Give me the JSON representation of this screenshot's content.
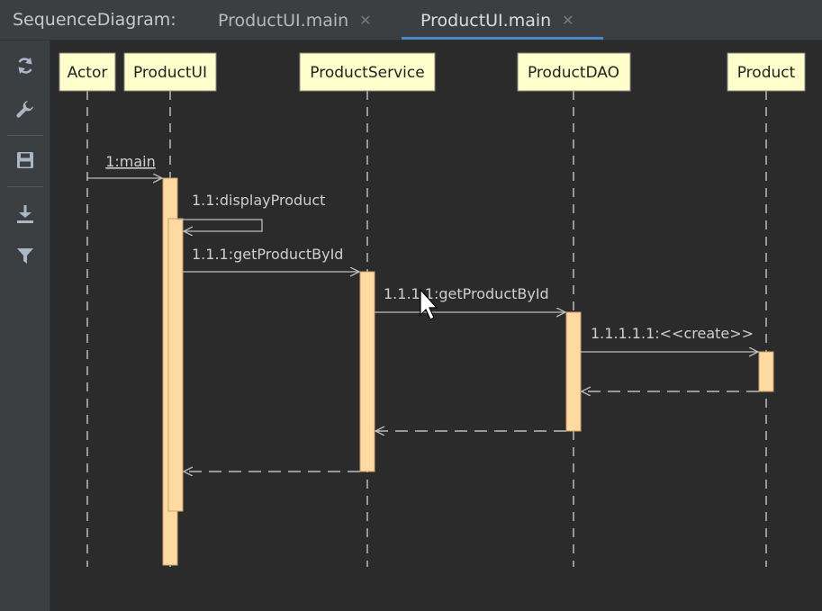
{
  "toolwindow": {
    "title": "SequenceDiagram:"
  },
  "tabs": [
    {
      "label": "ProductUI.main",
      "active": false
    },
    {
      "label": "ProductUI.main",
      "active": true
    }
  ],
  "toolbar": {
    "buttons": [
      {
        "icon": "refresh-icon"
      },
      {
        "icon": "wrench-icon"
      },
      {
        "icon": "save-icon"
      },
      {
        "icon": "export-icon"
      },
      {
        "icon": "filter-icon"
      }
    ]
  },
  "diagram": {
    "participants": [
      "Actor",
      "ProductUI",
      "ProductService",
      "ProductDAO",
      "Product"
    ],
    "messages": [
      {
        "label": "1:main",
        "from": "Actor",
        "to": "ProductUI",
        "kind": "call"
      },
      {
        "label": "1.1:displayProduct",
        "from": "ProductUI",
        "to": "ProductUI",
        "kind": "self"
      },
      {
        "label": "1.1.1:getProductById",
        "from": "ProductUI",
        "to": "ProductService",
        "kind": "call"
      },
      {
        "label": "1.1.1.1:getProductById",
        "from": "ProductService",
        "to": "ProductDAO",
        "kind": "call"
      },
      {
        "label": "1.1.1.1.1:<<create>>",
        "from": "ProductDAO",
        "to": "Product",
        "kind": "create"
      },
      {
        "label": "",
        "from": "Product",
        "to": "ProductDAO",
        "kind": "return"
      },
      {
        "label": "",
        "from": "ProductDAO",
        "to": "ProductService",
        "kind": "return"
      },
      {
        "label": "",
        "from": "ProductService",
        "to": "ProductUI",
        "kind": "return"
      }
    ]
  },
  "colors": {
    "participant_fill": "#ffffcc",
    "activation_fill": "#ffd9a0",
    "line": "#bdbdbd",
    "text": "#cfcfcf",
    "background": "#2b2b2b",
    "panel": "#3c3f41",
    "accent": "#4a88c7"
  }
}
